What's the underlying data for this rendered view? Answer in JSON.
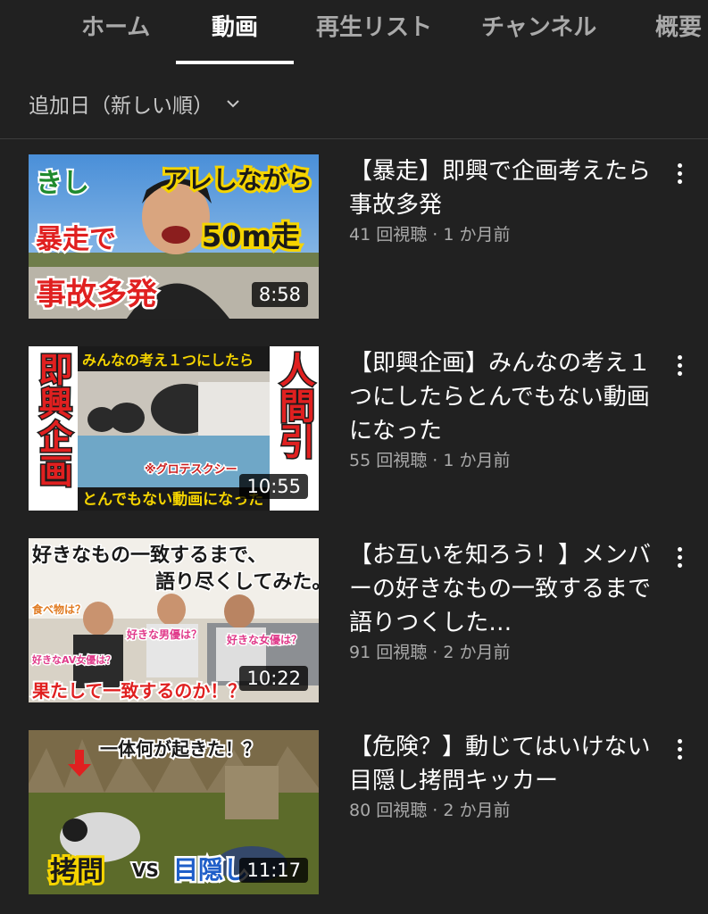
{
  "tabs": [
    "ホーム",
    "動画",
    "再生リスト",
    "チャンネル",
    "概要"
  ],
  "active_tab": "動画",
  "sort": {
    "label": "追加日（新しい順）"
  },
  "colors": {
    "background": "#212121",
    "text_primary": "#ffffff",
    "text_secondary": "#aaaaaa"
  },
  "videos": [
    {
      "title": "【暴走】即興で企画考えたら事故多発",
      "meta": "41 回視聴 · 1 か月前",
      "duration": "8:58",
      "thumb_texts": [
        "きし",
        "アレしながら",
        "暴走で",
        "50m走",
        "事故多発"
      ]
    },
    {
      "title": "【即興企画】みんなの考え１つにしたらとんでもない動画になった",
      "meta": "55 回視聴 · 1 か月前",
      "duration": "10:55",
      "thumb_texts": [
        "即興企画",
        "みんなの考え１つにしたら",
        "人間引",
        "※グロテスクシー",
        "とんでもない動画になった"
      ]
    },
    {
      "title": "【お互いを知ろう！】メンバーの好きなもの一致するまで語りつくした…",
      "meta": "91 回視聴 · 2 か月前",
      "duration": "10:22",
      "thumb_texts": [
        "好きなもの一致するまで、",
        "語り尽くしてみた。",
        "食べ物は？",
        "好きな男優は？",
        "好きな女優は？",
        "好きなAV女優は？",
        "果たして一致するのか！？"
      ]
    },
    {
      "title": "【危険？】動じてはいけない目隠し拷問キッカー",
      "meta": "80 回視聴 · 2 か月前",
      "duration": "11:17",
      "thumb_texts": [
        "一体何が起きた！？",
        "拷問",
        "VS",
        "目隠し"
      ]
    }
  ]
}
